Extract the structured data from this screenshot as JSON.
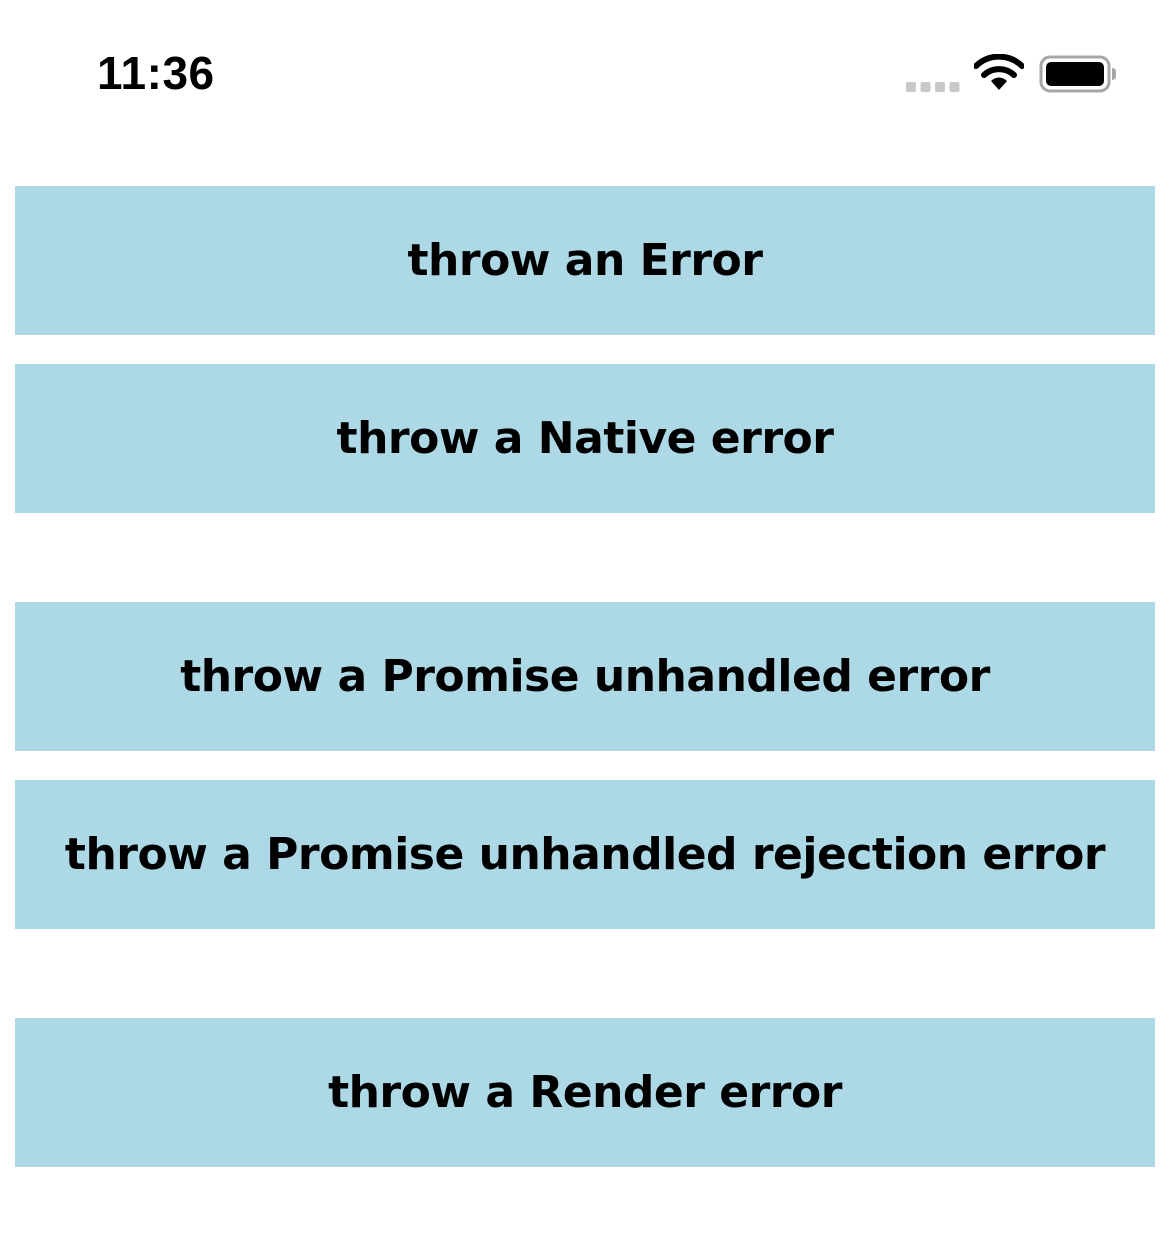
{
  "status_bar": {
    "time": "11:36",
    "icons": [
      "cellular-signal-icon",
      "wifi-icon",
      "battery-icon"
    ]
  },
  "buttons": [
    {
      "label": "throw an Error"
    },
    {
      "label": "throw a Native error"
    },
    {
      "label": "throw a Promise unhandled error"
    },
    {
      "label": "throw a Promise unhandled rejection error"
    },
    {
      "label": "throw a Render error"
    }
  ],
  "colors": {
    "button_background": "#add8e6",
    "text": "#000000",
    "background": "#ffffff"
  }
}
